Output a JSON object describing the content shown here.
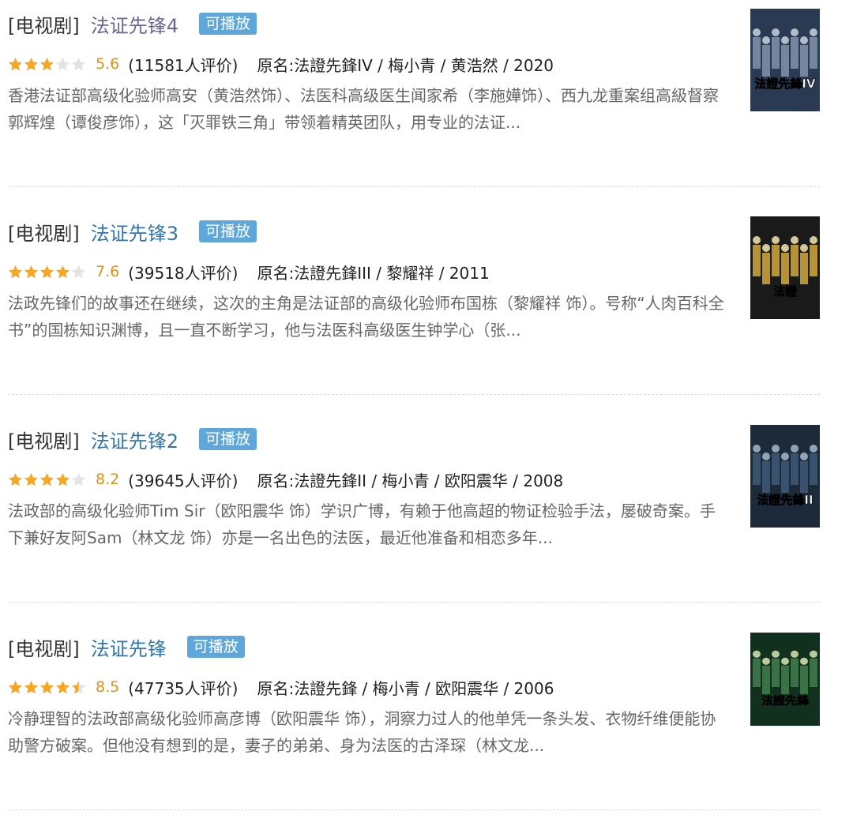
{
  "results": [
    {
      "type": "[电视剧]",
      "title": "法证先锋4",
      "badge": "可播放",
      "stars": [
        1,
        1,
        1,
        0,
        0
      ],
      "score": "5.6",
      "count": "(11581人评价)",
      "meta": "原名:法證先鋒IV / 梅小青 / 黄浩然 / 2020",
      "desc": "香港法证部高级化验师高安（黄浩然饰）、法医科高级医生闻家希（李施嬅饰）、西九龙重案组高級督察郭辉煌（谭俊彦饰），这「灭罪铁三角」带领着精英团队，用专业的法证...",
      "poster_text": "法證先鋒IV",
      "visited": true
    },
    {
      "type": "[电视剧]",
      "title": "法证先锋3",
      "badge": "可播放",
      "stars": [
        1,
        1,
        1,
        1,
        0
      ],
      "score": "7.6",
      "count": "(39518人评价)",
      "meta": "原名:法證先鋒III / 黎耀祥 / 2011",
      "desc": "法政先锋们的故事还在继续，这次的主角是法证部的高级化验师布国栋（黎耀祥 饰）。号称“人肉百科全书”的国栋知识渊博，且一直不断学习，他与法医科高级医生钟学心（张...",
      "poster_text": "法證",
      "visited": false
    },
    {
      "type": "[电视剧]",
      "title": "法证先锋2",
      "badge": "可播放",
      "stars": [
        1,
        1,
        1,
        1,
        0
      ],
      "score": "8.2",
      "count": "(39645人评价)",
      "meta": "原名:法證先鋒II / 梅小青 / 欧阳震华 / 2008",
      "desc": "法政部的高级化验师Tim Sir（欧阳震华 饰）学识广博，有赖于他高超的物证检验手法，屡破奇案。手下兼好友阿Sam（林文龙 饰）亦是一名出色的法医，最近他准备和相恋多年...",
      "poster_text": "法證先鋒II",
      "visited": false
    },
    {
      "type": "[电视剧]",
      "title": "法证先锋",
      "badge": "可播放",
      "stars": [
        1,
        1,
        1,
        1,
        0.5
      ],
      "score": "8.5",
      "count": "(47735人评价)",
      "meta": "原名:法證先鋒 / 梅小青 / 欧阳震华 / 2006",
      "desc": "冷静理智的法政部高级化验师高彦博（欧阳震华 饰），洞察力过人的他单凭一条头发、衣物纤维便能协助警方破案。但他没有想到的是，妻子的弟弟、身为法医的古泽琛（林文龙...",
      "poster_text": "法證先鋒",
      "visited": false
    }
  ],
  "colors": {
    "title_link": "#3377aa",
    "title_visited": "#666699",
    "badge_bg": "#5fa7db",
    "score": "#e09015",
    "star_on": "#f6a623",
    "star_off": "#e3e3e3"
  }
}
